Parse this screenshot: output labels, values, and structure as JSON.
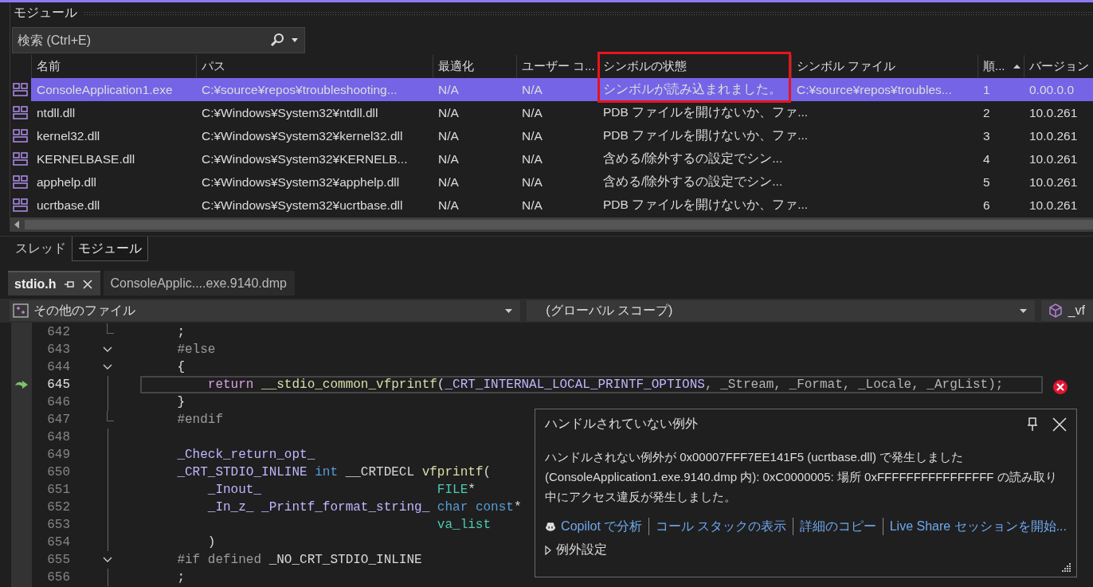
{
  "modules_panel": {
    "title": "モジュール",
    "search": {
      "placeholder": "検索 (Ctrl+E)"
    },
    "columns": [
      {
        "label": "名前",
        "sorted": false,
        "highlighted": false
      },
      {
        "label": "パス",
        "sorted": false,
        "highlighted": false
      },
      {
        "label": "最適化",
        "sorted": false,
        "highlighted": false
      },
      {
        "label": "ユーザー コ...",
        "sorted": false,
        "highlighted": false
      },
      {
        "label": "シンボルの状態",
        "sorted": false,
        "highlighted": true
      },
      {
        "label": "シンボル ファイル",
        "sorted": false,
        "highlighted": false
      },
      {
        "label": "順...",
        "sorted": true,
        "highlighted": false
      },
      {
        "label": "バージョン",
        "sorted": false,
        "highlighted": false
      }
    ],
    "rows": [
      {
        "selected": true,
        "cells": [
          "ConsoleApplication1.exe",
          "C:¥source¥repos¥troubleshooting...",
          "N/A",
          "N/A",
          "シンボルが読み込まれました。",
          "C:¥source¥repos¥troubles...",
          "1",
          "0.00.0.0"
        ]
      },
      {
        "selected": false,
        "cells": [
          "ntdll.dll",
          "C:¥Windows¥System32¥ntdll.dll",
          "N/A",
          "N/A",
          "PDB ファイルを開けないか、ファ...",
          "",
          "2",
          "10.0.261"
        ]
      },
      {
        "selected": false,
        "cells": [
          "kernel32.dll",
          "C:¥Windows¥System32¥kernel32.dll",
          "N/A",
          "N/A",
          "PDB ファイルを開けないか、ファ...",
          "",
          "3",
          "10.0.261"
        ]
      },
      {
        "selected": false,
        "cells": [
          "KERNELBASE.dll",
          "C:¥Windows¥System32¥KERNELB...",
          "N/A",
          "N/A",
          "含める/除外するの設定でシン...",
          "",
          "4",
          "10.0.261"
        ]
      },
      {
        "selected": false,
        "cells": [
          "apphelp.dll",
          "C:¥Windows¥System32¥apphelp.dll",
          "N/A",
          "N/A",
          "含める/除外するの設定でシン...",
          "",
          "5",
          "10.0.261"
        ]
      },
      {
        "selected": false,
        "cells": [
          "ucrtbase.dll",
          "C:¥Windows¥System32¥ucrtbase.dll",
          "N/A",
          "N/A",
          "PDB ファイルを開けないか、ファ...",
          "",
          "6",
          "10.0.261"
        ]
      }
    ]
  },
  "tool_tabs": [
    {
      "label": "スレッド",
      "selected": false
    },
    {
      "label": "モジュール",
      "selected": true
    }
  ],
  "editor": {
    "tabs": [
      {
        "label": "stdio.h",
        "selected": true
      },
      {
        "label": "ConsoleApplic....exe.9140.dmp",
        "selected": false
      }
    ],
    "nav": {
      "project": "その他のファイル",
      "scope": "(グローバル スコープ)",
      "member": "_vf"
    },
    "lines": [
      {
        "number": "642",
        "kind": "end",
        "current": false,
        "tokens": [
          {
            "text": "    ;",
            "kind": "plain"
          }
        ]
      },
      {
        "number": "643",
        "kind": "collapse",
        "current": false,
        "tokens": [
          {
            "text": "    #else",
            "kind": "pre"
          }
        ]
      },
      {
        "number": "644",
        "kind": "collapse",
        "current": false,
        "tokens": [
          {
            "text": "    {",
            "kind": "plain"
          }
        ]
      },
      {
        "number": "645",
        "kind": "line",
        "current": true,
        "tokens": [
          {
            "text": "        return",
            "kind": "control"
          },
          {
            "text": " __stdio_common_vfprintf",
            "kind": "func"
          },
          {
            "text": "(",
            "kind": "plain"
          },
          {
            "text": "_CRT_INTERNAL_LOCAL_PRINTF_OPTIONS",
            "kind": "macro"
          },
          {
            "text": ", _Stream, _Format, _Locale, _ArgList);",
            "kind": "param"
          }
        ]
      },
      {
        "number": "646",
        "kind": "line",
        "current": false,
        "tokens": [
          {
            "text": "    }",
            "kind": "plain"
          }
        ]
      },
      {
        "number": "647",
        "kind": "end",
        "current": false,
        "tokens": [
          {
            "text": "    #endif",
            "kind": "pre"
          }
        ]
      },
      {
        "number": "648",
        "kind": "line",
        "current": false
      },
      {
        "number": "649",
        "kind": "line",
        "current": false,
        "tokens": [
          {
            "text": "    _Check_return_opt_",
            "kind": "macro"
          }
        ]
      },
      {
        "number": "650",
        "kind": "line",
        "current": false,
        "tokens": [
          {
            "text": "    _CRT_STDIO_INLINE",
            "kind": "macro"
          },
          {
            "text": " int",
            "kind": "type"
          },
          {
            "text": " __CRTDECL",
            "kind": "plain"
          },
          {
            "text": " vfprintf",
            "kind": "func"
          },
          {
            "text": "(",
            "kind": "plain"
          }
        ]
      },
      {
        "number": "651",
        "kind": "line",
        "current": false,
        "tokens": [
          {
            "text": "        _Inout_",
            "kind": "macro"
          },
          {
            "text": "                       FILE",
            "kind": "class"
          },
          {
            "text": "*",
            "kind": "plain"
          }
        ]
      },
      {
        "number": "652",
        "kind": "line",
        "current": false,
        "tokens": [
          {
            "text": "        _In_z_ _Printf_format_string_",
            "kind": "macro"
          },
          {
            "text": " char const",
            "kind": "type"
          },
          {
            "text": "*",
            "kind": "plain"
          }
        ]
      },
      {
        "number": "653",
        "kind": "line",
        "current": false,
        "tokens": [
          {
            "text": "                                      va_list",
            "kind": "class"
          }
        ]
      },
      {
        "number": "654",
        "kind": "line",
        "current": false,
        "tokens": [
          {
            "text": "        )",
            "kind": "plain"
          }
        ]
      },
      {
        "number": "655",
        "kind": "collapse",
        "current": false,
        "tokens": [
          {
            "text": "    #if defined",
            "kind": "pre"
          },
          {
            "text": " _NO_CRT_STDIO_INLINE",
            "kind": "plain"
          }
        ]
      },
      {
        "number": "656",
        "kind": "line",
        "current": false,
        "tokens": [
          {
            "text": "    ;",
            "kind": "plain"
          }
        ]
      }
    ]
  },
  "exception": {
    "title": "ハンドルされていない例外",
    "message": "ハンドルされない例外が 0x00007FFF7EE141F5 (ucrtbase.dll) で発生しました (ConsoleApplication1.exe.9140.dmp 内): 0xC0000005: 場所 0xFFFFFFFFFFFFFFFF の読み取り中にアクセス違反が発生しました。",
    "links": [
      {
        "label": "Copilot で分析",
        "kind": "copilot"
      },
      {
        "label": "コール スタックの表示",
        "kind": "plain"
      },
      {
        "label": "詳細のコピー",
        "kind": "plain"
      },
      {
        "label": "Live Share セッションを開始...",
        "kind": "plain"
      }
    ],
    "settings": {
      "label": "例外設定",
      "expanded": false
    }
  }
}
